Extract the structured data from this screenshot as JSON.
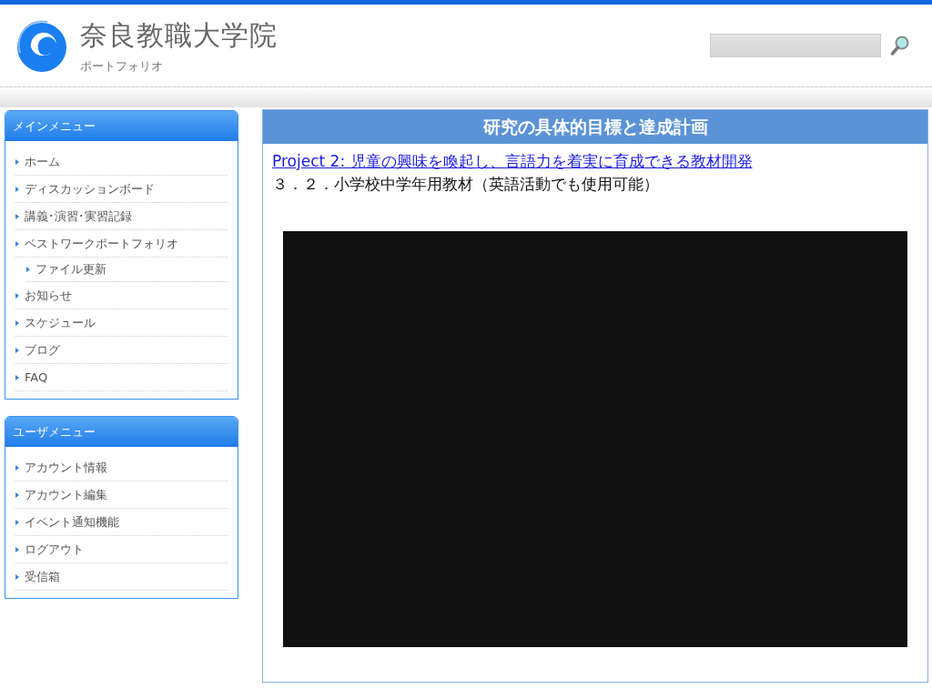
{
  "header": {
    "site_title": "奈良教職大学院",
    "site_subtitle": "ポートフォリオ"
  },
  "menus": [
    {
      "title": "メインメニュー",
      "items": [
        {
          "label": "ホーム"
        },
        {
          "label": "ディスカッションボード"
        },
        {
          "label": "講義･演習･実習記録"
        },
        {
          "label": "ベストワークポートフォリオ",
          "children": [
            {
              "label": "ファイル更新"
            }
          ]
        },
        {
          "label": "お知らせ"
        },
        {
          "label": "スケジュール"
        },
        {
          "label": "ブログ"
        },
        {
          "label": "FAQ"
        }
      ]
    },
    {
      "title": "ユーザメニュー",
      "items": [
        {
          "label": "アカウント情報"
        },
        {
          "label": "アカウント編集"
        },
        {
          "label": "イベント通知機能"
        },
        {
          "label": "ログアウト"
        },
        {
          "label": "受信箱"
        }
      ]
    }
  ],
  "content": {
    "title": "研究の具体的目標と達成計画",
    "link": "Project 2:  児童の興味を喚起し、言語力を着実に育成できる教材開発",
    "subtitle": "３．２．小学校中学年用教材（英語活動でも使用可能）"
  }
}
